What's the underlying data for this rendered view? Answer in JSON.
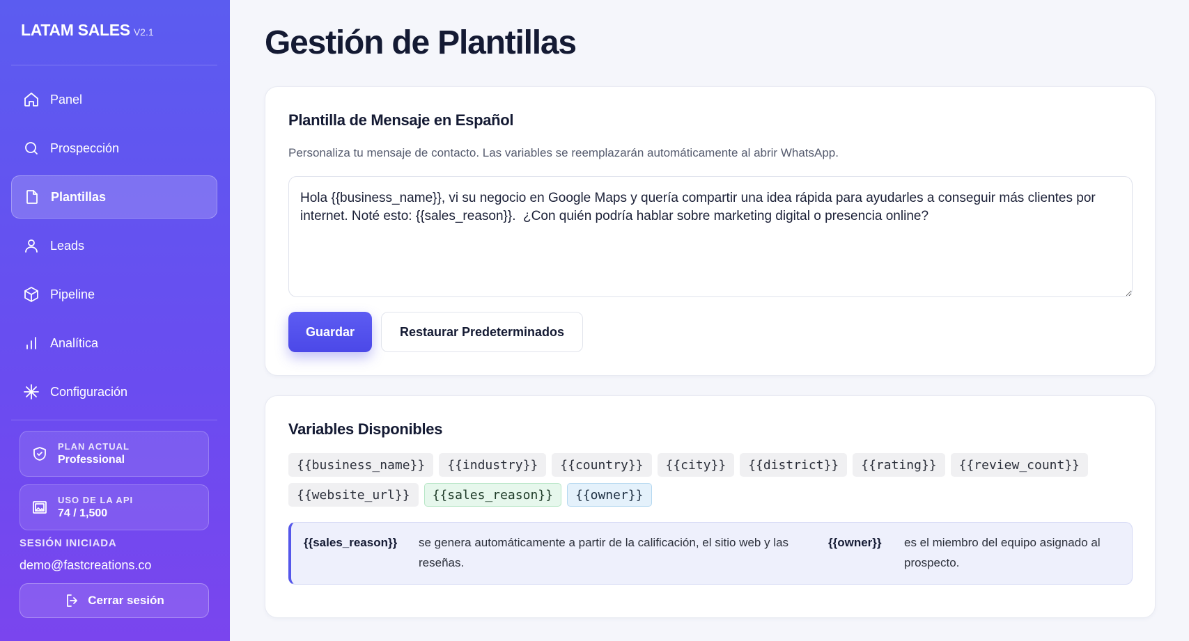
{
  "sidebar": {
    "brand": "LATAM SALES",
    "version": "V2.1",
    "items": [
      {
        "label": "Panel",
        "icon": "home-icon"
      },
      {
        "label": "Prospección",
        "icon": "search-icon"
      },
      {
        "label": "Plantillas",
        "icon": "document-icon",
        "active": true
      },
      {
        "label": "Leads",
        "icon": "user-icon"
      },
      {
        "label": "Pipeline",
        "icon": "cube-icon"
      },
      {
        "label": "Analítica",
        "icon": "bar-chart-icon"
      },
      {
        "label": "Configuración",
        "icon": "asterisk-icon"
      }
    ],
    "plan": {
      "label": "PLAN ACTUAL",
      "value": "Professional",
      "icon": "shield-icon"
    },
    "api": {
      "label": "USO DE LA API",
      "value": "74 / 1,500",
      "icon": "image-icon"
    },
    "session_label": "SESIÓN INICIADA",
    "email": "demo@fastcreations.co",
    "logout": "Cerrar sesión"
  },
  "main": {
    "title": "Gestión de Plantillas",
    "template_card": {
      "title": "Plantilla de Mensaje en Español",
      "description": "Personaliza tu mensaje de contacto. Las variables se reemplazarán automáticamente al abrir WhatsApp.",
      "template": "Hola {{business_name}}, vi su negocio en Google Maps y quería compartir una idea rápida para ayudarles a conseguir más clientes por internet. Noté esto: {{sales_reason}}.  ¿Con quién podría hablar sobre marketing digital o presencia online?",
      "save": "Guardar",
      "restore": "Restaurar Predeterminados"
    },
    "variables_card": {
      "title": "Variables Disponibles",
      "chips": [
        {
          "text": "{{business_name}}",
          "style": "plain"
        },
        {
          "text": "{{industry}}",
          "style": "plain"
        },
        {
          "text": "{{country}}",
          "style": "plain"
        },
        {
          "text": "{{city}}",
          "style": "plain"
        },
        {
          "text": "{{district}}",
          "style": "plain"
        },
        {
          "text": "{{rating}}",
          "style": "plain"
        },
        {
          "text": "{{review_count}}",
          "style": "plain"
        },
        {
          "text": "{{website_url}}",
          "style": "plain"
        },
        {
          "text": "{{sales_reason}}",
          "style": "green"
        },
        {
          "text": "{{owner}}",
          "style": "blue"
        }
      ],
      "note": {
        "key1": "{{sales_reason}}",
        "text1": "se genera automáticamente a partir de la calificación, el sitio web y las reseñas.",
        "key2": "{{owner}}",
        "text2": "es el miembro del equipo asignado al prospecto."
      }
    }
  }
}
